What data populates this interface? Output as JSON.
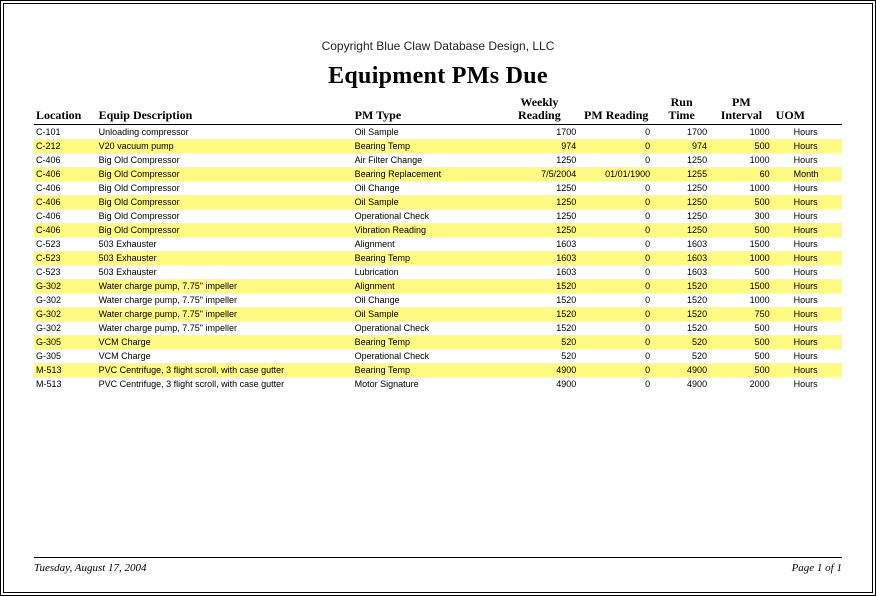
{
  "copyright": "Copyright Blue Claw Database Design, LLC",
  "title": "Equipment PMs Due",
  "columns": {
    "location": "Location",
    "equip_desc": "Equip Description",
    "pm_type": "PM Type",
    "weekly_reading": "Weekly Reading",
    "pm_reading": "PM Reading",
    "run_time": "Run Time",
    "pm_interval": "PM Interval",
    "uom": "UOM"
  },
  "rows": [
    {
      "location": "C-101",
      "equip_desc": "Unloading compressor",
      "pm_type": "Oil Sample",
      "weekly_reading": "1700",
      "pm_reading": "0",
      "run_time": "1700",
      "pm_interval": "1000",
      "uom": "Hours"
    },
    {
      "location": "C-212",
      "equip_desc": "V20 vacuum pump",
      "pm_type": "Bearing Temp",
      "weekly_reading": "974",
      "pm_reading": "0",
      "run_time": "974",
      "pm_interval": "500",
      "uom": "Hours"
    },
    {
      "location": "C-406",
      "equip_desc": "Big Old Compressor",
      "pm_type": "Air Filter Change",
      "weekly_reading": "1250",
      "pm_reading": "0",
      "run_time": "1250",
      "pm_interval": "1000",
      "uom": "Hours"
    },
    {
      "location": "C-406",
      "equip_desc": "Big Old Compressor",
      "pm_type": "Bearing Replacement",
      "weekly_reading": "7/5/2004",
      "pm_reading": "01/01/1900",
      "run_time": "1255",
      "pm_interval": "60",
      "uom": "Month"
    },
    {
      "location": "C-406",
      "equip_desc": "Big Old Compressor",
      "pm_type": "Oil Change",
      "weekly_reading": "1250",
      "pm_reading": "0",
      "run_time": "1250",
      "pm_interval": "1000",
      "uom": "Hours"
    },
    {
      "location": "C-406",
      "equip_desc": "Big Old Compressor",
      "pm_type": "Oil Sample",
      "weekly_reading": "1250",
      "pm_reading": "0",
      "run_time": "1250",
      "pm_interval": "500",
      "uom": "Hours"
    },
    {
      "location": "C-406",
      "equip_desc": "Big Old Compressor",
      "pm_type": "Operational Check",
      "weekly_reading": "1250",
      "pm_reading": "0",
      "run_time": "1250",
      "pm_interval": "300",
      "uom": "Hours"
    },
    {
      "location": "C-406",
      "equip_desc": "Big Old Compressor",
      "pm_type": "Vibration Reading",
      "weekly_reading": "1250",
      "pm_reading": "0",
      "run_time": "1250",
      "pm_interval": "500",
      "uom": "Hours"
    },
    {
      "location": "C-523",
      "equip_desc": "503 Exhauster",
      "pm_type": "Alignment",
      "weekly_reading": "1603",
      "pm_reading": "0",
      "run_time": "1603",
      "pm_interval": "1500",
      "uom": "Hours"
    },
    {
      "location": "C-523",
      "equip_desc": "503 Exhauster",
      "pm_type": "Bearing Temp",
      "weekly_reading": "1603",
      "pm_reading": "0",
      "run_time": "1603",
      "pm_interval": "1000",
      "uom": "Hours"
    },
    {
      "location": "C-523",
      "equip_desc": "503 Exhauster",
      "pm_type": "Lubrication",
      "weekly_reading": "1603",
      "pm_reading": "0",
      "run_time": "1603",
      "pm_interval": "500",
      "uom": "Hours"
    },
    {
      "location": "G-302",
      "equip_desc": "Water charge pump, 7.75\" impeller",
      "pm_type": "Alignment",
      "weekly_reading": "1520",
      "pm_reading": "0",
      "run_time": "1520",
      "pm_interval": "1500",
      "uom": "Hours"
    },
    {
      "location": "G-302",
      "equip_desc": "Water charge pump, 7.75\" impeller",
      "pm_type": "Oil Change",
      "weekly_reading": "1520",
      "pm_reading": "0",
      "run_time": "1520",
      "pm_interval": "1000",
      "uom": "Hours"
    },
    {
      "location": "G-302",
      "equip_desc": "Water charge pump, 7.75\" impeller",
      "pm_type": "Oil Sample",
      "weekly_reading": "1520",
      "pm_reading": "0",
      "run_time": "1520",
      "pm_interval": "750",
      "uom": "Hours"
    },
    {
      "location": "G-302",
      "equip_desc": "Water charge pump, 7.75\" impeller",
      "pm_type": "Operational Check",
      "weekly_reading": "1520",
      "pm_reading": "0",
      "run_time": "1520",
      "pm_interval": "500",
      "uom": "Hours"
    },
    {
      "location": "G-305",
      "equip_desc": "VCM Charge",
      "pm_type": "Bearing Temp",
      "weekly_reading": "520",
      "pm_reading": "0",
      "run_time": "520",
      "pm_interval": "500",
      "uom": "Hours"
    },
    {
      "location": "G-305",
      "equip_desc": "VCM Charge",
      "pm_type": "Operational Check",
      "weekly_reading": "520",
      "pm_reading": "0",
      "run_time": "520",
      "pm_interval": "500",
      "uom": "Hours"
    },
    {
      "location": "M-513",
      "equip_desc": "PVC Centrifuge, 3 flight scroll, with case gutter",
      "pm_type": "Bearing Temp",
      "weekly_reading": "4900",
      "pm_reading": "0",
      "run_time": "4900",
      "pm_interval": "500",
      "uom": "Hours"
    },
    {
      "location": "M-513",
      "equip_desc": "PVC Centrifuge, 3 flight scroll, with case gutter",
      "pm_type": "Motor Signature",
      "weekly_reading": "4900",
      "pm_reading": "0",
      "run_time": "4900",
      "pm_interval": "2000",
      "uom": "Hours"
    }
  ],
  "footer": {
    "date": "Tuesday, August 17, 2004",
    "page": "Page 1 of 1"
  }
}
